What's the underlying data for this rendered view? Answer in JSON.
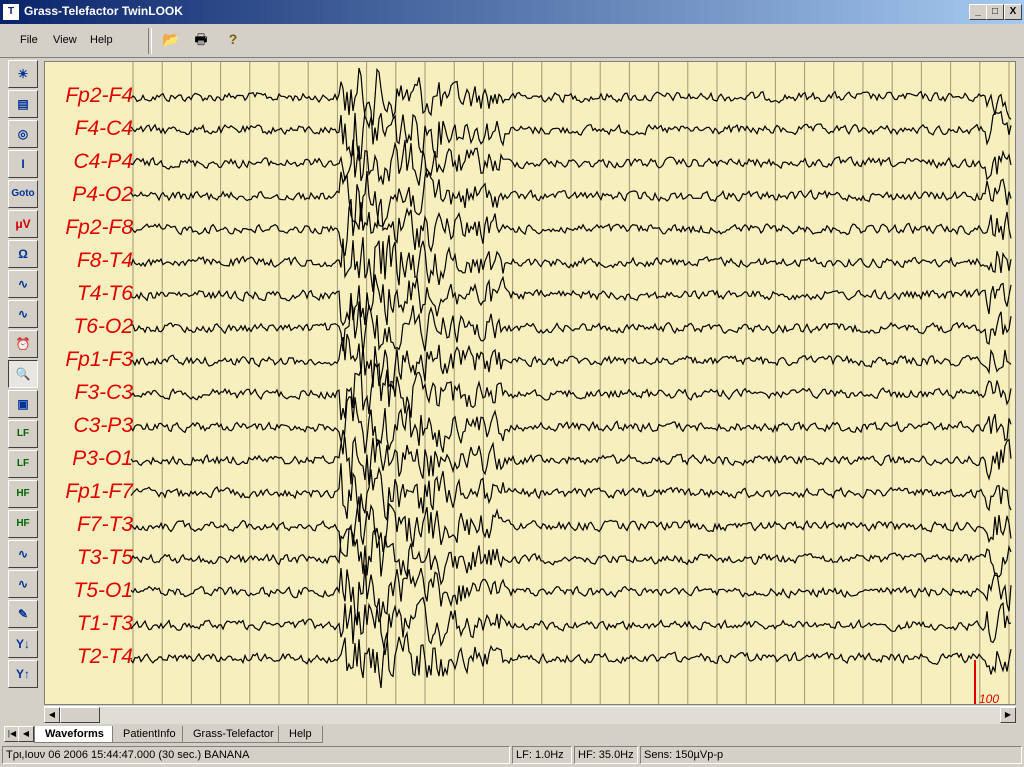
{
  "window": {
    "title": "Grass-Telefactor TwinLOOK",
    "buttons": [
      "_",
      "□",
      "X"
    ]
  },
  "menu": [
    "File",
    "View",
    "Help"
  ],
  "toolbar": {
    "icons": [
      {
        "name": "open-folder-icon",
        "glyph": "📂"
      },
      {
        "name": "print-icon",
        "glyph": "🖶"
      },
      {
        "name": "help-icon",
        "glyph": "?"
      }
    ]
  },
  "left_tools": [
    {
      "name": "lightbulb-icon",
      "glyph": "☀"
    },
    {
      "name": "clipboard-icon",
      "glyph": "▤"
    },
    {
      "name": "montage-icon",
      "glyph": "◎"
    },
    {
      "name": "cursor-icon",
      "glyph": "I"
    },
    {
      "name": "goto-button",
      "glyph": "Goto"
    },
    {
      "name": "sensitivity-icon",
      "glyph": "μV"
    },
    {
      "name": "impedance-icon",
      "glyph": "Ω"
    },
    {
      "name": "wave-up-icon",
      "glyph": "∿"
    },
    {
      "name": "wave-down-icon",
      "glyph": "∿"
    },
    {
      "name": "alarm-icon",
      "glyph": "⏰"
    },
    {
      "name": "zoom-icon",
      "glyph": "🔍"
    },
    {
      "name": "video-icon",
      "glyph": "▣"
    },
    {
      "name": "lf-down-icon",
      "glyph": "LF"
    },
    {
      "name": "lf-up-icon",
      "glyph": "LF"
    },
    {
      "name": "hf-down-icon",
      "glyph": "HF"
    },
    {
      "name": "hf-up-icon",
      "glyph": "HF"
    },
    {
      "name": "notch-icon",
      "glyph": "∿"
    },
    {
      "name": "notch-off-icon",
      "glyph": "∿"
    },
    {
      "name": "pen-icon",
      "glyph": "✎"
    },
    {
      "name": "tool-down-icon",
      "glyph": "Y↓"
    },
    {
      "name": "tool-up-icon",
      "glyph": "Y↑"
    }
  ],
  "channels": [
    "Fp2-F4",
    "F4-C4",
    "C4-P4",
    "P4-O2",
    "Fp2-F8",
    "F8-T4",
    "T4-T6",
    "T6-O2",
    "Fp1-F3",
    "F3-C3",
    "C3-P3",
    "P3-O1",
    "Fp1-F7",
    "F7-T3",
    "T3-T5",
    "T5-O1",
    "T1-T3",
    "T2-T4"
  ],
  "scale_label": "100",
  "tabs": [
    "Waveforms",
    "PatientInfo",
    "Grass-Telefactor",
    "Help"
  ],
  "status": {
    "datetime": "Τρι,Ιουν 06 2006  15:44:47.000 (30 sec.) BANANA",
    "lf": "LF:  1.0Hz",
    "hf": "HF: 35.0Hz",
    "sens": "Sens:  150µVp-p"
  },
  "colors": {
    "trace_bg": "#f7efbd",
    "label": "#e00000",
    "trace": "#000000"
  }
}
